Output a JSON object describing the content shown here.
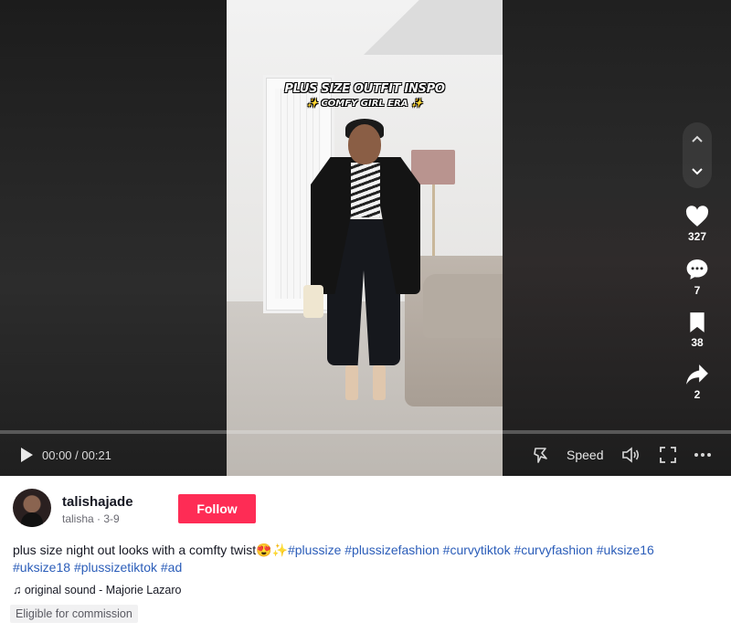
{
  "video": {
    "caption_line1": "PLUS SIZE OUTFIT INSPO",
    "caption_line2": "COMFY GIRL ERA",
    "sparkle": "✨"
  },
  "player": {
    "time": "00:00 / 00:21",
    "speed_label": "Speed",
    "progress": 0
  },
  "actions": {
    "likes": "327",
    "comments": "7",
    "saves": "38",
    "shares": "2"
  },
  "author": {
    "username": "talishajade",
    "nickname": "talisha",
    "date": "3-9",
    "follow_label": "Follow"
  },
  "description": {
    "text": "plus size night out looks with a comfty twist😍✨",
    "hashtags": [
      "#plussize",
      "#plussizefashion",
      "#curvytiktok",
      "#curvyfashion",
      "#uksize16",
      "#uksize18",
      "#plussizetiktok",
      "#ad"
    ]
  },
  "sound": {
    "icon": "♫",
    "label": "original sound - Majorie Lazaro"
  },
  "badge": "Eligible for commission",
  "colors": {
    "follow": "#fe2c55",
    "hashtag": "#2b5db9"
  }
}
